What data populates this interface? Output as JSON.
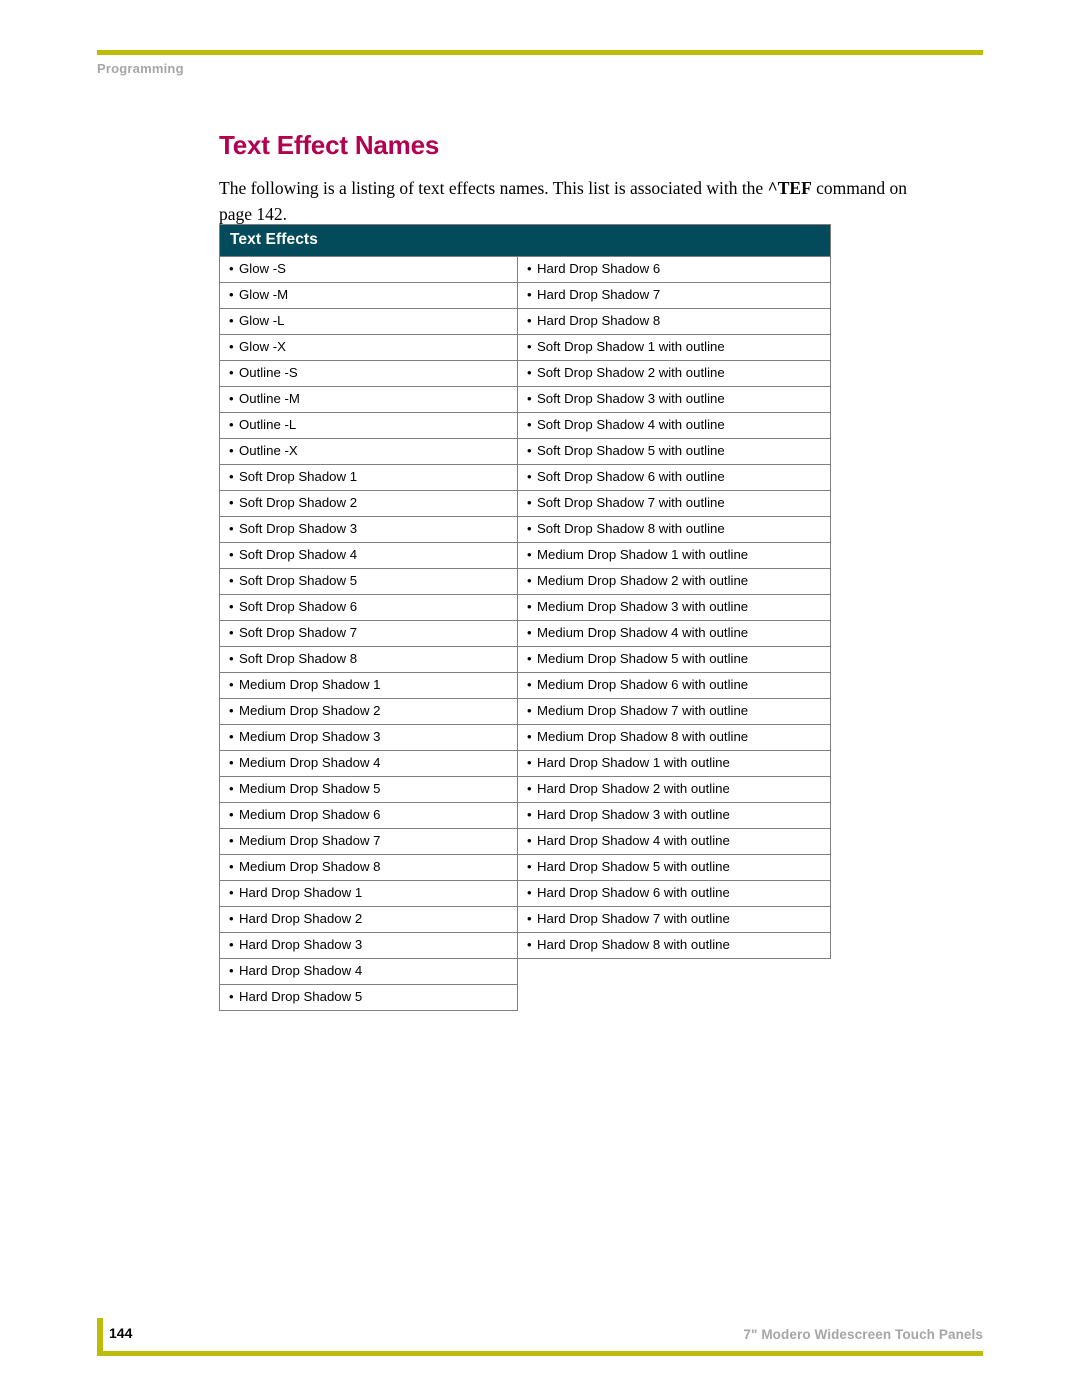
{
  "header": {
    "running_head": "Programming",
    "rule_color": "#bdbd09"
  },
  "title": {
    "text": "Text Effect Names",
    "color": "#b3004f"
  },
  "intro": {
    "part1": "The following is a listing of text effects names. This list is associated with the ",
    "command": "^TEF",
    "part2": " command on page 142."
  },
  "table": {
    "header_label": "Text Effects",
    "header_bg": "#034a5a",
    "header_text_color": "#ffffff",
    "border_color": "#7f7f7f",
    "bullet": "•",
    "rows": [
      {
        "left": "Glow -S",
        "right": "Hard Drop Shadow 6"
      },
      {
        "left": "Glow -M",
        "right": "Hard Drop Shadow 7"
      },
      {
        "left": "Glow -L",
        "right": "Hard Drop Shadow 8"
      },
      {
        "left": "Glow -X",
        "right": "Soft Drop Shadow 1 with outline"
      },
      {
        "left": "Outline -S",
        "right": "Soft Drop Shadow 2 with outline"
      },
      {
        "left": "Outline -M",
        "right": "Soft Drop Shadow 3 with outline"
      },
      {
        "left": "Outline -L",
        "right": "Soft Drop Shadow 4 with outline"
      },
      {
        "left": "Outline -X",
        "right": "Soft Drop Shadow 5 with outline"
      },
      {
        "left": "Soft Drop Shadow 1",
        "right": "Soft Drop Shadow 6 with outline"
      },
      {
        "left": "Soft Drop Shadow 2",
        "right": "Soft Drop Shadow 7 with outline"
      },
      {
        "left": "Soft Drop Shadow 3",
        "right": "Soft Drop Shadow 8 with outline"
      },
      {
        "left": "Soft Drop Shadow 4",
        "right": "Medium Drop Shadow 1 with outline"
      },
      {
        "left": "Soft Drop Shadow 5",
        "right": "Medium Drop Shadow 2 with outline"
      },
      {
        "left": "Soft Drop Shadow 6",
        "right": "Medium Drop Shadow 3 with outline"
      },
      {
        "left": "Soft Drop Shadow 7",
        "right": "Medium Drop Shadow 4 with outline"
      },
      {
        "left": "Soft Drop Shadow 8",
        "right": "Medium Drop Shadow 5 with outline"
      },
      {
        "left": "Medium Drop Shadow 1",
        "right": "Medium Drop Shadow 6 with outline"
      },
      {
        "left": "Medium Drop Shadow 2",
        "right": "Medium Drop Shadow 7 with outline"
      },
      {
        "left": "Medium Drop Shadow 3",
        "right": "Medium Drop Shadow 8 with outline"
      },
      {
        "left": "Medium Drop Shadow 4",
        "right": "Hard Drop Shadow 1 with outline"
      },
      {
        "left": "Medium Drop Shadow 5",
        "right": "Hard Drop Shadow 2 with outline"
      },
      {
        "left": "Medium Drop Shadow 6",
        "right": "Hard Drop Shadow 3 with outline"
      },
      {
        "left": "Medium Drop Shadow 7",
        "right": "Hard Drop Shadow 4 with outline"
      },
      {
        "left": "Medium Drop Shadow 8",
        "right": "Hard Drop Shadow 5 with outline"
      },
      {
        "left": "Hard Drop Shadow 1",
        "right": "Hard Drop Shadow 6 with outline"
      },
      {
        "left": "Hard Drop Shadow 2",
        "right": "Hard Drop Shadow 7 with outline"
      },
      {
        "left": "Hard Drop Shadow 3",
        "right": "Hard Drop Shadow 8 with outline"
      },
      {
        "left": "Hard Drop Shadow 4",
        "right": null
      },
      {
        "left": "Hard Drop Shadow 5",
        "right": null
      }
    ]
  },
  "footer": {
    "page_number": "144",
    "document_title": "7\" Modero Widescreen Touch Panels",
    "rule_color": "#bdbd09"
  }
}
